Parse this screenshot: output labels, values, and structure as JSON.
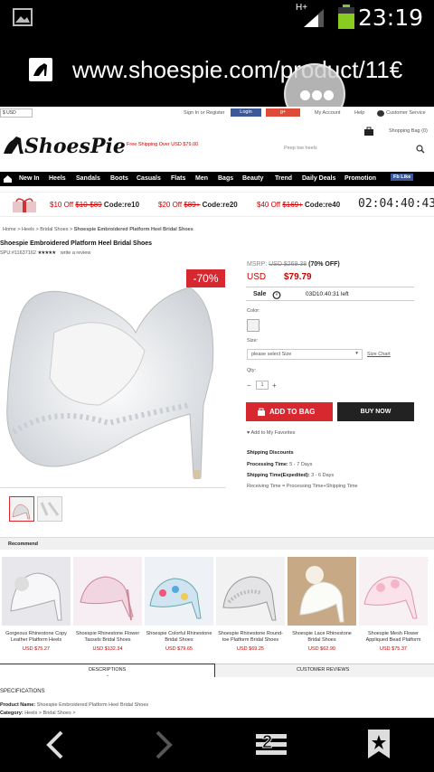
{
  "status_bar": {
    "time": "23:19",
    "signal_label": "H+"
  },
  "browser": {
    "url": "www.shoespie.com/product/11€",
    "tab_count": "2"
  },
  "topbar": {
    "currency": "$ USD",
    "signin": "Sign In or Register",
    "login": "Login",
    "my_account": "My Account",
    "help": "Help",
    "customer_service": "Customer Service",
    "shopping_bag": "Shopping Bag (0)"
  },
  "header": {
    "logo_text": "ShoesPie",
    "free_shipping": "Free Shipping Over USD $79.00",
    "search_placeholder": "Peep toe heels"
  },
  "nav": {
    "items": [
      "New In",
      "Heels",
      "Sandals",
      "Boots",
      "Casuals",
      "Flats",
      "Men",
      "Bags",
      "Beauty",
      "Trend",
      "Daily Deals",
      "Promotion"
    ],
    "fb_label": "Fb Like"
  },
  "promo": {
    "deals": [
      {
        "off": "$10 Off",
        "range": "$10-$89",
        "code": "Code:re10"
      },
      {
        "off": "$20 Off",
        "range": "$89+",
        "code": "Code:re20"
      },
      {
        "off": "$40 Off",
        "range": "$169+",
        "code": "Code:re40"
      }
    ],
    "countdown": "02:04:40:43"
  },
  "breadcrumb": [
    "Home",
    "Heels",
    "Bridal Shoes",
    "Shoespie Embroidered Platform Heel Bridal Shoes"
  ],
  "product": {
    "title": "Shoespie Embroidered Platform Heel Bridal Shoes",
    "spu": "SPU:#11637162",
    "write_review": "write a review",
    "discount_badge": "-70%",
    "msrp_label": "MSRP:",
    "msrp_value": "USD $269.38",
    "off_label": "(70% OFF)",
    "currency": "USD",
    "price": "$79.79",
    "sale_label": "Sale",
    "sale_timer": "03D10:40:31 left",
    "color_label": "Color:",
    "size_label": "Size:",
    "size_placeholder": "please select Size",
    "size_chart": "Size Chart",
    "qty_label": "Qty:",
    "qty_value": "1",
    "add_to_bag": "ADD TO BAG",
    "buy_now": "BUY NOW",
    "add_favorites": "Add to My Favorites",
    "shipping_discounts": "Shipping Discounts",
    "processing_time_label": "Processing Time:",
    "processing_time": "5 - 7 Days",
    "shipping_time_label": "Shipping Time(Expedited):",
    "shipping_time": "3 - 6 Days",
    "receiving_time": "Receiving Time = Processing Time+Shipping Time"
  },
  "recommend": {
    "title": "Recommend",
    "items": [
      {
        "name": "Gorgeous Rhinestone Copy Leather Platform Heels",
        "price": "USD $75.27"
      },
      {
        "name": "Shoespie Rhinestone Flower Tassels Bridal Shoes",
        "price": "USD $132.34"
      },
      {
        "name": "Shoespie Colorful Rhinestone Bridal Shoes",
        "price": "USD $79.65"
      },
      {
        "name": "Shoespie Rhinestone Round-toe Platform Bridal Shoes",
        "price": "USD $69.25"
      },
      {
        "name": "Shoespie Lace Rhinestone Bridal Shoes",
        "price": "USD $62.90"
      },
      {
        "name": "Shoespie Mesh Flower Appliqued Bead Platform",
        "price": "USD $75.37"
      }
    ]
  },
  "tabs": {
    "descriptions": "DESCRIPTIONS",
    "reviews": "CUSTOMER REVIEWS"
  },
  "specs": {
    "title": "SPECIFICATIONS",
    "product_name_label": "Product Name:",
    "product_name": "Shoespie Embroidered Platform Heel Bridal Shoes",
    "category_label": "Category:",
    "category": "Heels > Bridal Shoes >"
  },
  "colors": {
    "accent_red": "#d7282f",
    "nav_black": "#000000"
  }
}
